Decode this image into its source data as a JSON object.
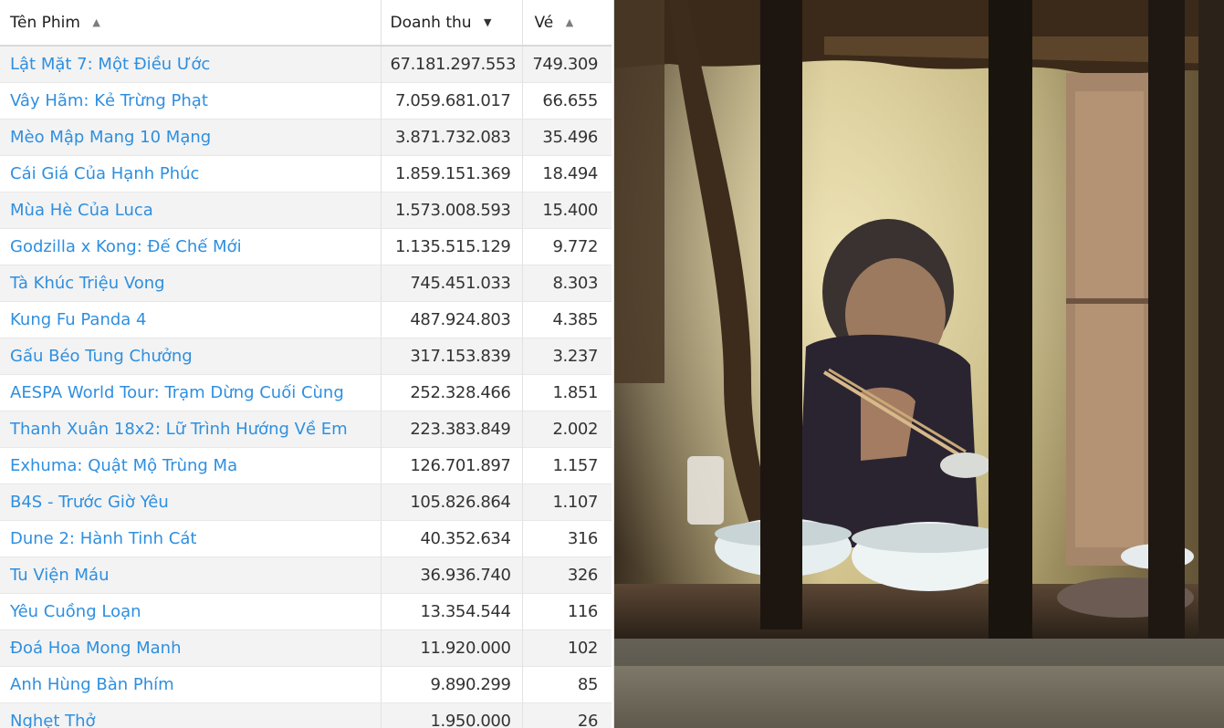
{
  "table": {
    "headers": {
      "name": "Tên Phim",
      "revenue": "Doanh thu",
      "tickets": "Vé"
    },
    "sort_icons": {
      "name": "▲",
      "revenue": "▼",
      "tickets": "▲"
    },
    "rows": [
      {
        "name": "Lật Mặt 7: Một Điều Ước",
        "revenue": "67.181.297.553",
        "tickets": "749.309"
      },
      {
        "name": "Vây Hãm: Kẻ Trừng Phạt",
        "revenue": "7.059.681.017",
        "tickets": "66.655"
      },
      {
        "name": "Mèo Mập Mang 10 Mạng",
        "revenue": "3.871.732.083",
        "tickets": "35.496"
      },
      {
        "name": "Cái Giá Của Hạnh Phúc",
        "revenue": "1.859.151.369",
        "tickets": "18.494"
      },
      {
        "name": "Mùa Hè Của Luca",
        "revenue": "1.573.008.593",
        "tickets": "15.400"
      },
      {
        "name": "Godzilla x Kong: Đế Chế Mới",
        "revenue": "1.135.515.129",
        "tickets": "9.772"
      },
      {
        "name": "Tà Khúc Triệu Vong",
        "revenue": "745.451.033",
        "tickets": "8.303"
      },
      {
        "name": "Kung Fu Panda 4",
        "revenue": "487.924.803",
        "tickets": "4.385"
      },
      {
        "name": "Gấu Béo Tung Chưởng",
        "revenue": "317.153.839",
        "tickets": "3.237"
      },
      {
        "name": "AESPA World Tour: Trạm Dừng Cuối Cùng",
        "revenue": "252.328.466",
        "tickets": "1.851"
      },
      {
        "name": "Thanh Xuân 18x2: Lữ Trình Hướng Về Em",
        "revenue": "223.383.849",
        "tickets": "2.002"
      },
      {
        "name": "Exhuma: Quật Mộ Trùng Ma",
        "revenue": "126.701.897",
        "tickets": "1.157"
      },
      {
        "name": "B4S - Trước Giờ Yêu",
        "revenue": "105.826.864",
        "tickets": "1.107"
      },
      {
        "name": "Dune 2: Hành Tinh Cát",
        "revenue": "40.352.634",
        "tickets": "316"
      },
      {
        "name": "Tu Viện Máu",
        "revenue": "36.936.740",
        "tickets": "326"
      },
      {
        "name": "Yêu Cuồng Loạn",
        "revenue": "13.354.544",
        "tickets": "116"
      },
      {
        "name": "Đoá Hoa Mong Manh",
        "revenue": "11.920.000",
        "tickets": "102"
      },
      {
        "name": "Anh Hùng Bàn Phím",
        "revenue": "9.890.299",
        "tickets": "85"
      },
      {
        "name": "Nghẹt Thở",
        "revenue": "1.950.000",
        "tickets": "26"
      }
    ]
  },
  "colors": {
    "link": "#2e8fe0",
    "row_alt": "#f3f3f3",
    "header_border": "#d9d9d9"
  }
}
